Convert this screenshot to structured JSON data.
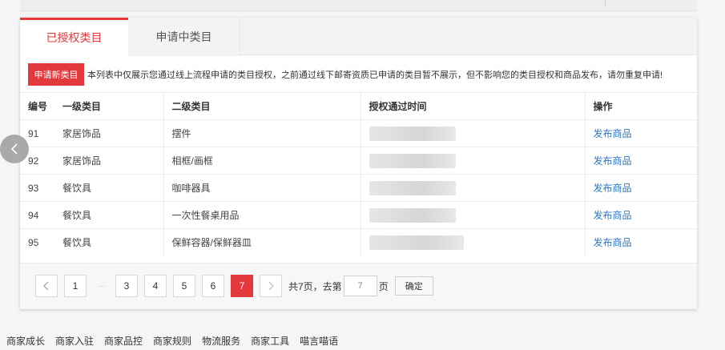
{
  "tabs": [
    {
      "label": "已授权类目",
      "active": true
    },
    {
      "label": "申请中类目",
      "active": false
    }
  ],
  "notice": {
    "apply_button": "申请新类目",
    "text": "本列表中仅展示您通过线上流程申请的类目授权，之前通过线下邮寄资质已申请的类目暂不展示，但不影响您的类目授权和商品发布，请勿重复申请!"
  },
  "table": {
    "headers": [
      "编号",
      "一级类目",
      "二级类目",
      "授权通过时间",
      "操作"
    ],
    "rows": [
      {
        "id": "91",
        "level1": "家居饰品",
        "level2": "摆件",
        "action": "发布商品"
      },
      {
        "id": "92",
        "level1": "家居饰品",
        "level2": "相框/画框",
        "action": "发布商品"
      },
      {
        "id": "93",
        "level1": "餐饮具",
        "level2": "咖啡器具",
        "action": "发布商品"
      },
      {
        "id": "94",
        "level1": "餐饮具",
        "level2": "一次性餐桌用品",
        "action": "发布商品"
      },
      {
        "id": "95",
        "level1": "餐饮具",
        "level2": "保鲜容器/保鲜器皿",
        "action": "发布商品"
      }
    ]
  },
  "pagination": {
    "prev_icon": "chevron-left-icon",
    "next_icon": "chevron-right-icon",
    "pages_before": [
      "1"
    ],
    "ellipsis": "···",
    "pages": [
      "3",
      "4",
      "5",
      "6"
    ],
    "current": "7",
    "total_text": "共7页，去第",
    "input_value": "7",
    "suffix": "页",
    "confirm": "确定"
  },
  "footer": {
    "links": [
      "商家成长",
      "商家入驻",
      "商家品控",
      "商家规则",
      "物流服务",
      "商家工具",
      "喵言喵语"
    ]
  },
  "colors": {
    "accent": "#e4393c",
    "link": "#2a78c6"
  }
}
